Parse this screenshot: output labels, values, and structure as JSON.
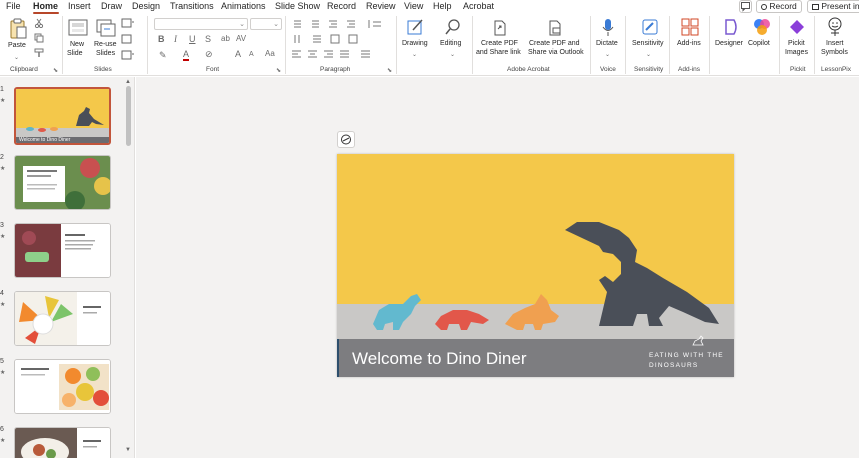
{
  "menu": {
    "file": "File",
    "home": "Home",
    "insert": "Insert",
    "draw": "Draw",
    "design": "Design",
    "animations": "Animations",
    "transitions": "Transitions",
    "slideshow": "Slide Show",
    "record": "Record",
    "review": "Review",
    "view": "View",
    "help": "Help",
    "acrobat": "Acrobat",
    "record_button": "Record",
    "present_button": "Present in"
  },
  "ribbon": {
    "paste": "Paste",
    "clipboard_group": "Clipboard",
    "new_slide": [
      "New",
      "Slide"
    ],
    "reuse_slides": [
      "Re-use",
      "Slides"
    ],
    "slides_group": "Slides",
    "font_group": "Font",
    "paragraph_group": "Paragraph",
    "drawing": "Drawing",
    "editing": "Editing",
    "create_pdf_share": [
      "Create PDF",
      "and Share link"
    ],
    "create_pdf_outlook": [
      "Create PDF and",
      "Share via Outlook"
    ],
    "adobe_group": "Adobe Acrobat",
    "dictate": "Dictate",
    "voice_group": "Voice",
    "sensitivity": "Sensitivity",
    "sensitivity_group": "Sensitivity",
    "addins": "Add-ins",
    "addins_group": "Add-ins",
    "designer": "Designer",
    "copilot": "Copilot",
    "pickit": [
      "Pickit",
      "Images"
    ],
    "pickit_group": "Pickit",
    "insert_symbols": [
      "Insert",
      "Symbols"
    ],
    "lessonpix_group": "LessonPix",
    "bold": "B",
    "italic": "I",
    "underline": "U",
    "strike": "S",
    "grow_font": "A",
    "shrink_font": "A",
    "font_color": "A"
  },
  "slides": [
    {
      "number": "1",
      "caption": "Welcome to Dino Diner"
    },
    {
      "number": "2",
      "caption": ""
    },
    {
      "number": "3",
      "caption": ""
    },
    {
      "number": "4",
      "caption": ""
    },
    {
      "number": "5",
      "caption": ""
    },
    {
      "number": "6",
      "caption": ""
    }
  ],
  "current_slide": {
    "title": "Welcome to Dino Diner",
    "subtitle": "EATING WITH THE DINOSAURS"
  },
  "colors": {
    "accent": "#b7472a",
    "slide_background": "#f4c84a",
    "selection": "#c2553b"
  }
}
